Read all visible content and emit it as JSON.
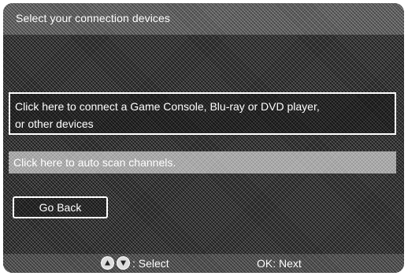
{
  "header": {
    "title": "Select your connection devices"
  },
  "options": {
    "device_line1": "Click here to connect a Game Console, Blu-ray or DVD player,",
    "device_line2": "or other devices",
    "autoscan": "Click here to auto scan channels."
  },
  "actions": {
    "go_back": "Go Back"
  },
  "footer": {
    "select_hint": ": Select",
    "ok_hint": "OK: Next",
    "icons": [
      "up-arrow-icon",
      "down-arrow-icon"
    ]
  }
}
